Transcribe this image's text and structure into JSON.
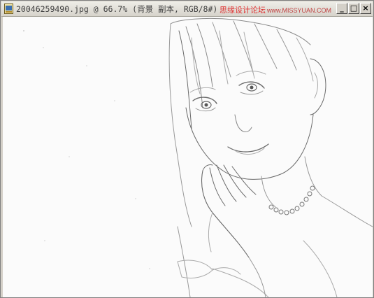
{
  "window": {
    "title": "20046259490.jpg @ 66.7% (背景 副本, RGB/8#)",
    "watermark": "思缘设计论坛",
    "watermark_url": "www.MISSYUAN.COM",
    "icons": {
      "document": "photoshop-document-icon",
      "minimize": "minimize-icon",
      "maximize": "maximize-icon",
      "close": "close-icon"
    },
    "buttons": {
      "minimize": "_",
      "maximize": "□",
      "close": "×"
    }
  },
  "canvas": {
    "image": "pencil-sketch-portrait",
    "colors": {
      "paper": "#fbfbfb",
      "line": "#6a6a6a",
      "faint": "#b8b8b8"
    }
  }
}
